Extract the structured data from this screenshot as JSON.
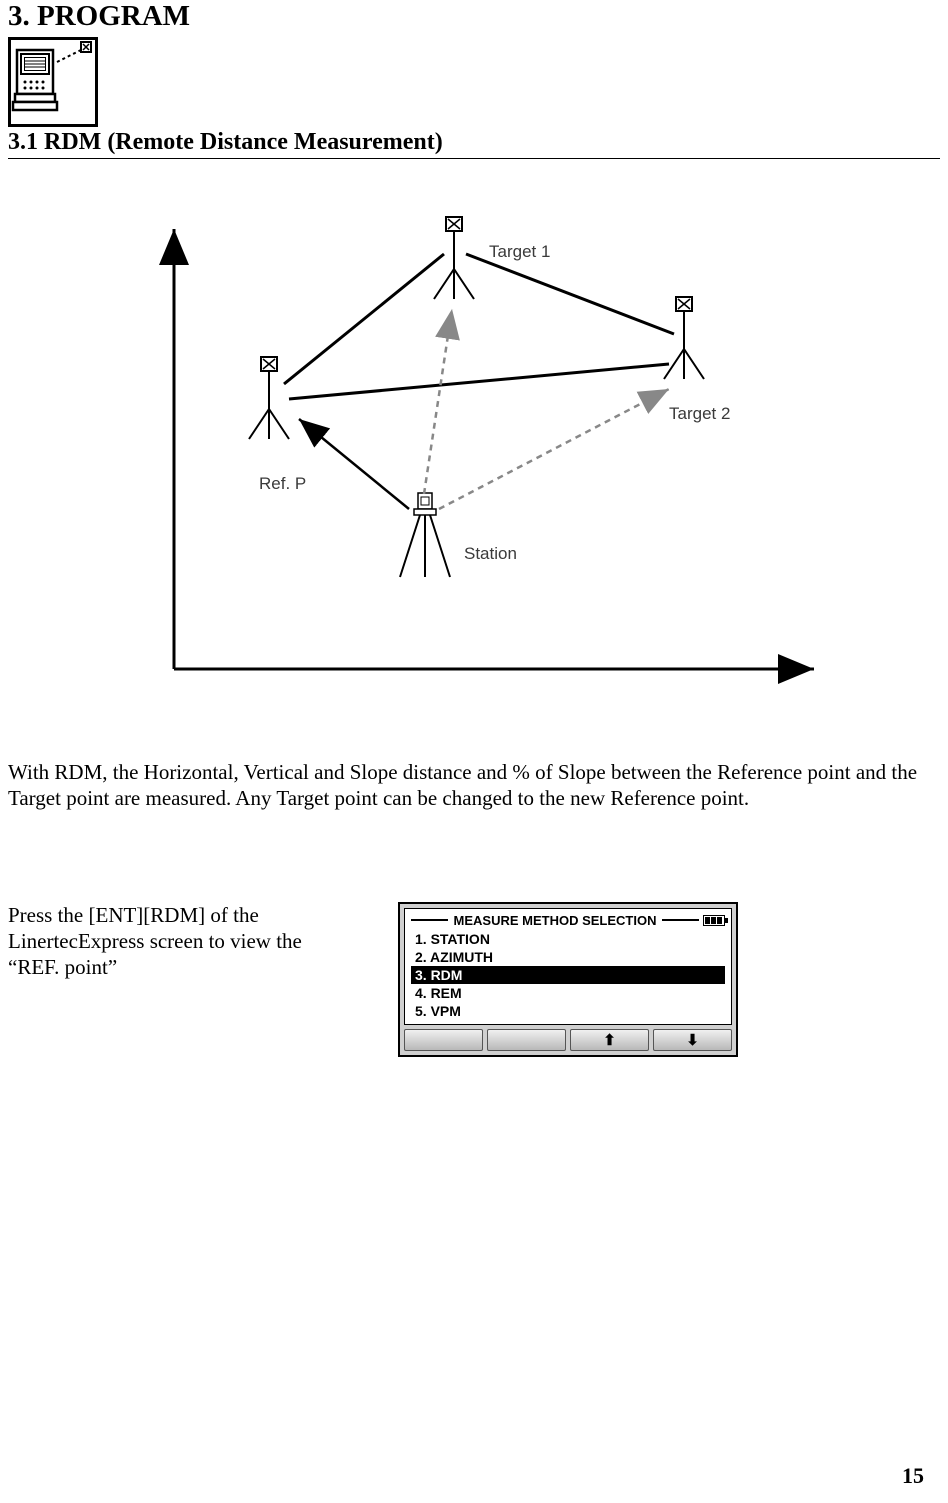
{
  "section_title": "3. PROGRAM",
  "subsection_title": "3.1 RDM (Remote Distance Measurement)",
  "diagram": {
    "target1": "Target 1",
    "target2": "Target 2",
    "refp": "Ref. P",
    "station": "Station"
  },
  "body_text": "With RDM, the Horizontal, Vertical and Slope distance and % of Slope between the Reference point and the Target point are measured. Any Target point can be changed to the new Reference point.",
  "instruction_text": "Press the [ENT][RDM] of the LinertecExpress screen to view the “REF. point”",
  "screen": {
    "title": "MEASURE METHOD SELECTION",
    "items": [
      "1.  STATION",
      "2.  AZIMUTH",
      "3.  RDM",
      "4.  REM",
      "5.  VPM"
    ],
    "selected_index": 2,
    "buttons": [
      "",
      "",
      "⬆",
      "⬇"
    ]
  },
  "page_number": "15"
}
